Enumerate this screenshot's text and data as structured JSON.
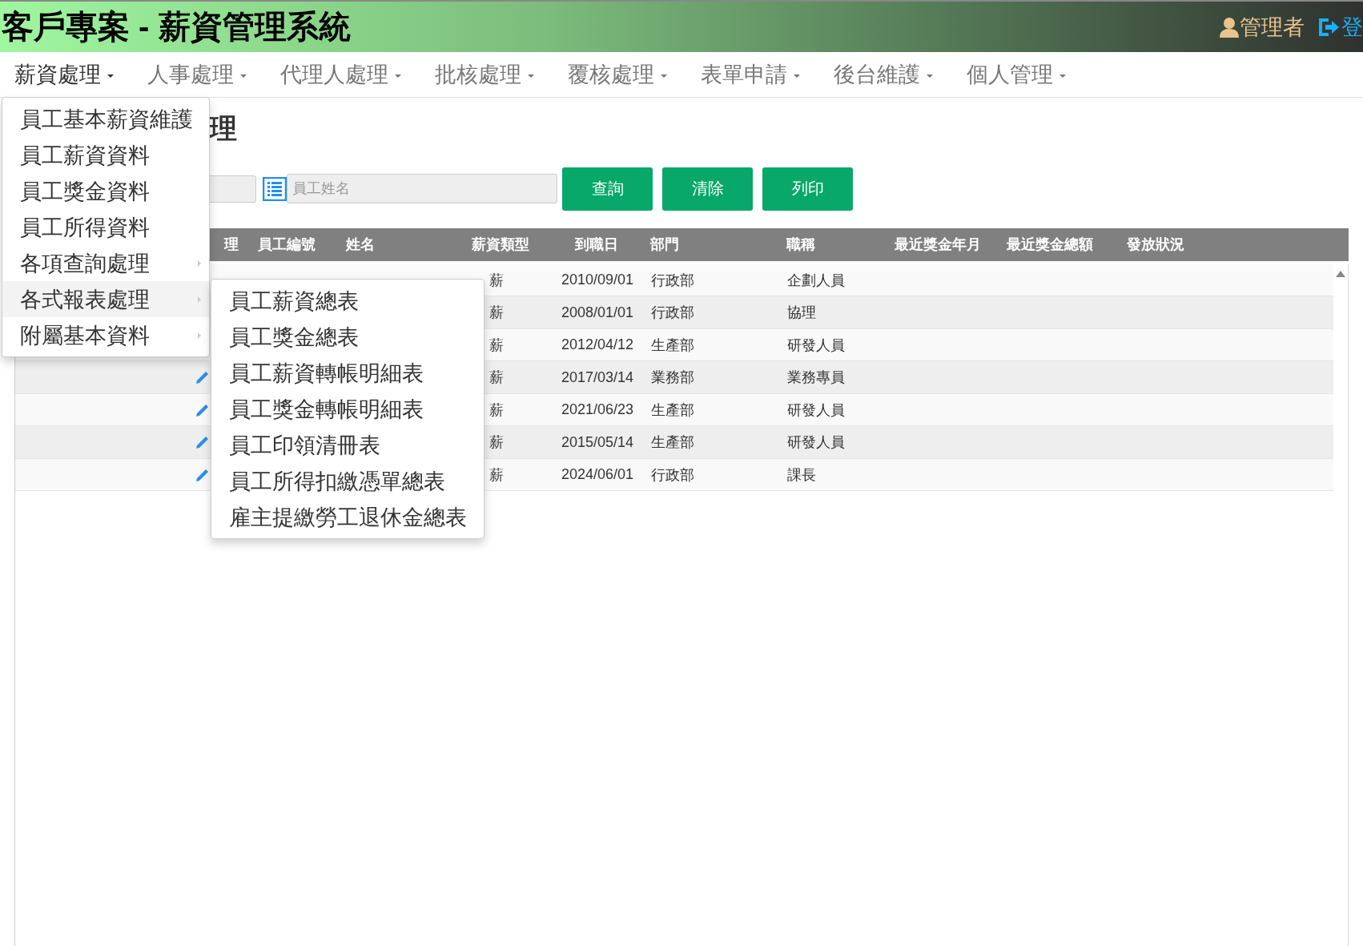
{
  "app_title": "客戶專案 - 薪資管理系統",
  "user": {
    "name": "管理者",
    "logout": "登"
  },
  "nav": [
    {
      "label": "薪資處理",
      "open": true
    },
    {
      "label": "人事處理",
      "open": false
    },
    {
      "label": "代理人處理",
      "open": false
    },
    {
      "label": "批核處理",
      "open": false
    },
    {
      "label": "覆核處理",
      "open": false
    },
    {
      "label": "表單申請",
      "open": false
    },
    {
      "label": "後台維護",
      "open": false
    },
    {
      "label": "個人管理",
      "open": false
    }
  ],
  "page_title": "理",
  "search": {
    "name_placeholder": "員工姓名",
    "buttons": [
      "查詢",
      "清除",
      "列印"
    ]
  },
  "table": {
    "columns": [
      "理",
      "員工編號",
      "姓名",
      "薪資類型",
      "到職日",
      "部門",
      "職稱",
      "最近獎金年月",
      "最近獎金總額",
      "發放狀況"
    ],
    "rows": [
      {
        "salary_type": "薪",
        "hire_date": "2010/09/01",
        "department": "行政部",
        "title": "企劃人員"
      },
      {
        "salary_type": "薪",
        "hire_date": "2008/01/01",
        "department": "行政部",
        "title": "協理"
      },
      {
        "salary_type": "薪",
        "hire_date": "2012/04/12",
        "department": "生產部",
        "title": "研發人員"
      },
      {
        "salary_type": "薪",
        "hire_date": "2017/03/14",
        "department": "業務部",
        "title": "業務專員"
      },
      {
        "salary_type": "薪",
        "hire_date": "2021/06/23",
        "department": "生產部",
        "title": "研發人員"
      },
      {
        "salary_type": "薪",
        "hire_date": "2015/05/14",
        "department": "生產部",
        "title": "研發人員"
      },
      {
        "salary_type": "薪",
        "hire_date": "2024/06/01",
        "department": "行政部",
        "title": "課長"
      }
    ]
  },
  "menu": [
    {
      "label": "員工基本薪資維護",
      "submenu": false,
      "selected": false
    },
    {
      "label": "員工薪資資料",
      "submenu": false,
      "selected": false
    },
    {
      "label": "員工獎金資料",
      "submenu": false,
      "selected": false
    },
    {
      "label": "員工所得資料",
      "submenu": false,
      "selected": false
    },
    {
      "label": "各項查詢處理",
      "submenu": true,
      "selected": false
    },
    {
      "label": "各式報表處理",
      "submenu": true,
      "selected": true
    },
    {
      "label": "附屬基本資料",
      "submenu": true,
      "selected": false
    }
  ],
  "submenu": [
    "員工薪資總表",
    "員工獎金總表",
    "員工薪資轉帳明細表",
    "員工獎金轉帳明細表",
    "員工印領清冊表",
    "員工所得扣繳憑單總表",
    "雇主提繳勞工退休金總表"
  ]
}
